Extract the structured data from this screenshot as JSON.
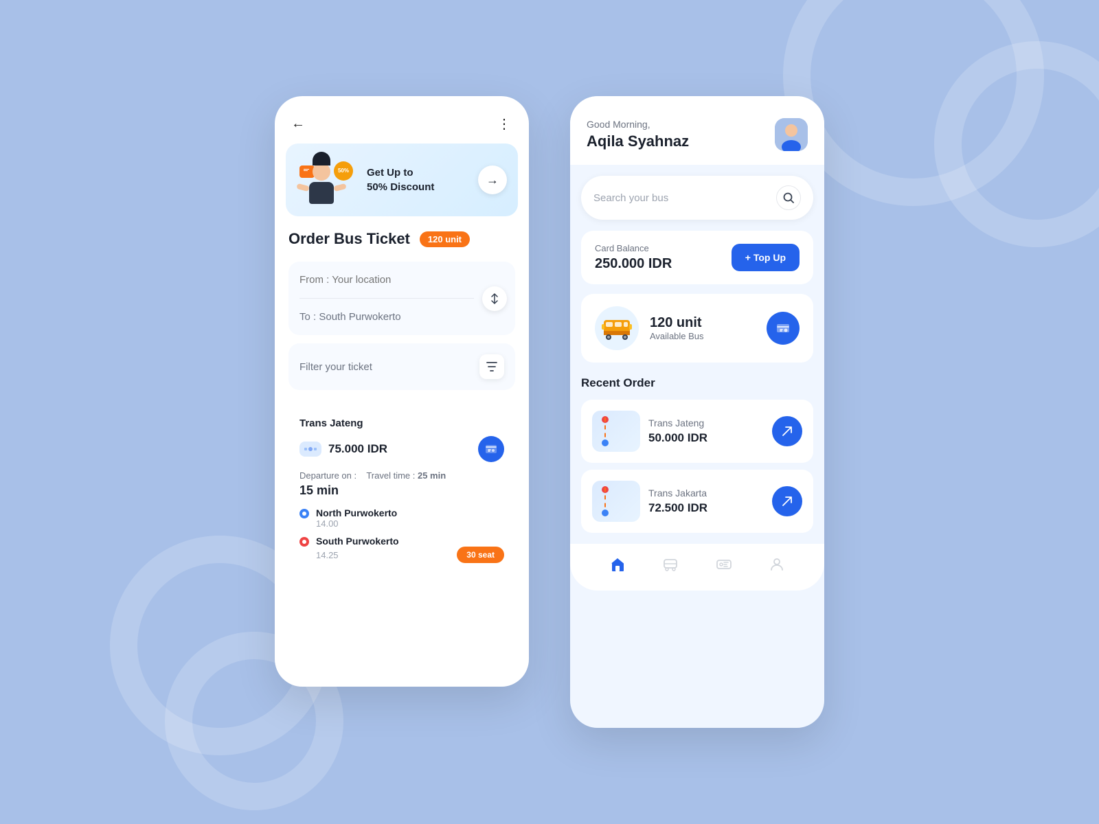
{
  "background": {
    "color": "#a8c0e8"
  },
  "left_phone": {
    "back_button": "←",
    "more_button": "⋮",
    "banner": {
      "title": "Get Up to\n50% Discount",
      "discount_badge": "50%",
      "arrow": "→"
    },
    "order_section": {
      "title": "Order Bus Ticket",
      "unit_badge": "120 unit",
      "from_placeholder": "From : Your location",
      "to_value": "To : South Purwokerto",
      "filter_placeholder": "Filter your ticket"
    },
    "ticket": {
      "company": "Trans Jateng",
      "price": "75.000 IDR",
      "departure_label": "Departure on :",
      "travel_label": "Travel time :",
      "travel_time": "25 min",
      "depart_time": "15 min",
      "from_stop": "North Purwokerto",
      "from_time": "14.00",
      "to_stop": "South Purwokerto",
      "to_time": "14.25",
      "seat_badge": "30 seat"
    }
  },
  "right_phone": {
    "greeting_small": "Good Morning,",
    "greeting_name": "Aqila Syahnaz",
    "search_placeholder": "Search your bus",
    "card_balance": {
      "label": "Card Balance",
      "amount": "250.000 IDR",
      "topup_label": "+ Top Up"
    },
    "bus_info": {
      "unit": "120 unit",
      "available": "Available Bus"
    },
    "recent_orders": {
      "title": "Recent Order",
      "items": [
        {
          "company": "Trans Jateng",
          "price": "50.000 IDR"
        },
        {
          "company": "Trans Jakarta",
          "price": "72.500 IDR"
        }
      ]
    },
    "bottom_nav": {
      "items": [
        "home",
        "bus",
        "ticket",
        "profile"
      ]
    }
  }
}
